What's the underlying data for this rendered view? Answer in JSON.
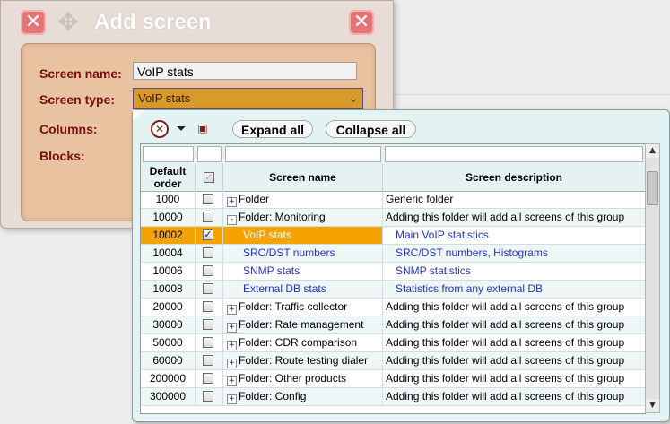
{
  "dialog": {
    "title": "Add screen",
    "move_icon": "move-arrows-icon",
    "close_icon": "close-icon",
    "fields": {
      "name_label": "Screen name:",
      "name_value": "VoIP stats",
      "type_label": "Screen type:",
      "type_value": "VoIP stats",
      "columns_label": "Columns:",
      "blocks_label": "Blocks:"
    }
  },
  "popup": {
    "toolbar": {
      "clear_icon": "clear-x-icon",
      "filter_icon": "filter-clear-icon",
      "save_icon": "save-disk-icon",
      "expand_label": "Expand all",
      "collapse_label": "Collapse all"
    },
    "columns": {
      "order": "Default order",
      "name": "Screen name",
      "desc": "Screen description"
    },
    "rows": [
      {
        "order": "1000",
        "checked": false,
        "toggle": "+",
        "name": "Folder",
        "desc": "Generic folder",
        "child": false,
        "selected": false
      },
      {
        "order": "10000",
        "checked": false,
        "toggle": "-",
        "name": "Folder: Monitoring",
        "desc": "Adding this folder will add all screens of this group",
        "child": false,
        "selected": false
      },
      {
        "order": "10002",
        "checked": true,
        "toggle": "",
        "name": "VoIP stats",
        "desc": "Main VoIP statistics",
        "child": true,
        "selected": true
      },
      {
        "order": "10004",
        "checked": false,
        "toggle": "",
        "name": "SRC/DST numbers",
        "desc": "SRC/DST numbers, Histograms",
        "child": true,
        "selected": false
      },
      {
        "order": "10006",
        "checked": false,
        "toggle": "",
        "name": "SNMP stats",
        "desc": "SNMP statistics",
        "child": true,
        "selected": false
      },
      {
        "order": "10008",
        "checked": false,
        "toggle": "",
        "name": "External DB stats",
        "desc": "Statistics from any external DB",
        "child": true,
        "selected": false
      },
      {
        "order": "20000",
        "checked": false,
        "toggle": "+",
        "name": "Folder: Traffic collector",
        "desc": "Adding this folder will add all screens of this group",
        "child": false,
        "selected": false
      },
      {
        "order": "30000",
        "checked": false,
        "toggle": "+",
        "name": "Folder: Rate management",
        "desc": "Adding this folder will add all screens of this group",
        "child": false,
        "selected": false
      },
      {
        "order": "50000",
        "checked": false,
        "toggle": "+",
        "name": "Folder: CDR comparison",
        "desc": "Adding this folder will add all screens of this group",
        "child": false,
        "selected": false
      },
      {
        "order": "60000",
        "checked": false,
        "toggle": "+",
        "name": "Folder: Route testing dialer",
        "desc": "Adding this folder will add all screens of this group",
        "child": false,
        "selected": false
      },
      {
        "order": "200000",
        "checked": false,
        "toggle": "+",
        "name": "Folder: Other products",
        "desc": "Adding this folder will add all screens of this group",
        "child": false,
        "selected": false
      },
      {
        "order": "300000",
        "checked": false,
        "toggle": "+",
        "name": "Folder: Config",
        "desc": "Adding this folder will add all screens of this group",
        "child": false,
        "selected": false
      }
    ]
  },
  "colors": {
    "selected_row": "#f5a300",
    "child_text": "#2233cc",
    "type_select": "#d89a2a"
  }
}
